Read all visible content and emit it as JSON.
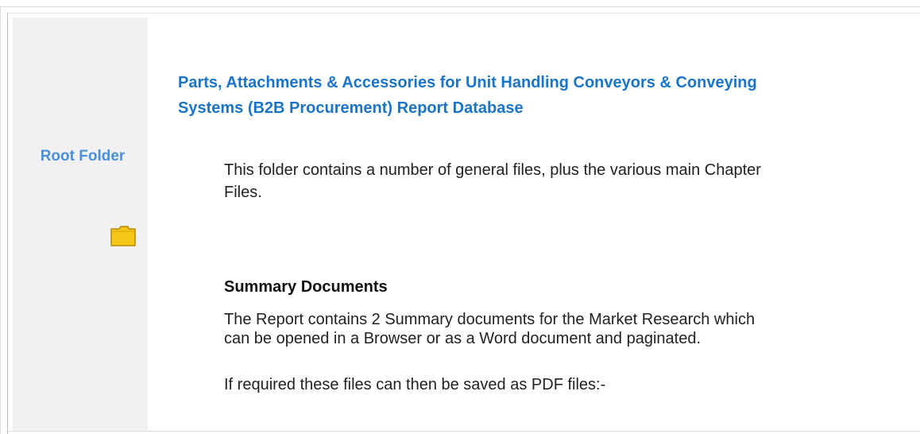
{
  "sidebar": {
    "label": "Root Folder",
    "icon": "folder-icon",
    "icon_color": "#f5c518"
  },
  "main": {
    "title": "Parts, Attachments & Accessories for Unit Handling Conveyors & Conveying Systems (B2B Procurement) Report Database",
    "intro": "This folder contains a number of general files, plus the various main Chapter Files.",
    "section_heading": "Summary Documents",
    "summary_text": "The Report contains 2 Summary documents for the Market Research which can be opened in a Browser or as a Word document and paginated.",
    "pdf_note": "If required these files can then be saved as PDF files:-"
  },
  "colors": {
    "title": "#1a74c7",
    "sidebar_label": "#4a90d9",
    "sidebar_bg": "#f1f1f1"
  }
}
